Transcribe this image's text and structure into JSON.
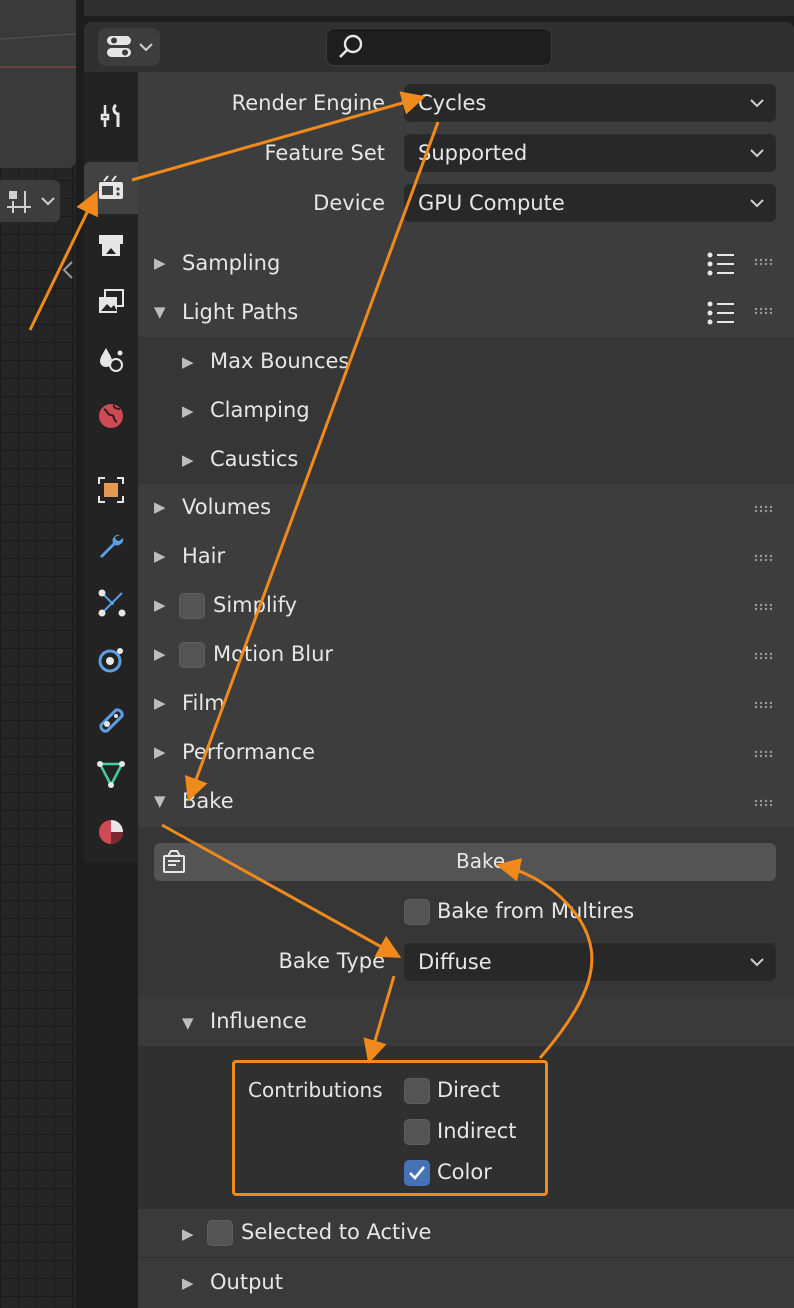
{
  "render": {
    "engine_label": "Render Engine",
    "engine_value": "Cycles",
    "feature_label": "Feature Set",
    "feature_value": "Supported",
    "device_label": "Device",
    "device_value": "GPU Compute"
  },
  "panels": {
    "sampling": "Sampling",
    "light_paths": "Light Paths",
    "max_bounces": "Max Bounces",
    "clamping": "Clamping",
    "caustics": "Caustics",
    "volumes": "Volumes",
    "hair": "Hair",
    "simplify": "Simplify",
    "motion_blur": "Motion Blur",
    "film": "Film",
    "performance": "Performance",
    "bake": "Bake"
  },
  "bake": {
    "button_label": "Bake",
    "from_multires_label": "Bake from Multires",
    "from_multires_checked": false,
    "type_label": "Bake Type",
    "type_value": "Diffuse",
    "influence_label": "Influence",
    "contributions_label": "Contributions",
    "direct_label": "Direct",
    "direct_checked": false,
    "indirect_label": "Indirect",
    "indirect_checked": false,
    "color_label": "Color",
    "color_checked": true,
    "selected_to_active_label": "Selected to Active",
    "output_label": "Output"
  },
  "colors": {
    "annotation": "#f08a1c",
    "checkbox_on": "#4772b3",
    "panel_bg": "#3d3d3d"
  },
  "icons": [
    "wrench-screwdriver-icon",
    "render-icon",
    "output-icon",
    "view-layer-icon",
    "scene-icon",
    "world-icon",
    "object-icon",
    "modifier-icon",
    "particles-icon",
    "physics-icon",
    "constraints-icon",
    "data-icon",
    "material-icon",
    "search-icon",
    "editor-type-icon",
    "drag-handle-icon",
    "list-icon"
  ]
}
